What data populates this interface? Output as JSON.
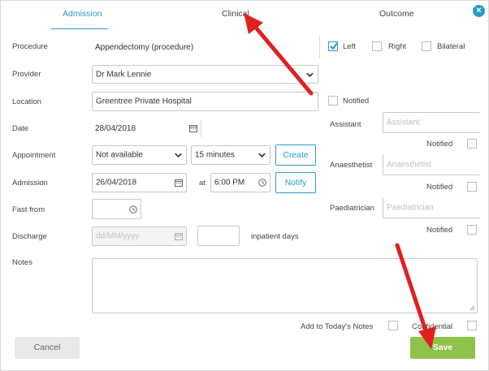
{
  "tabs": [
    {
      "label": "Admission",
      "active": true
    },
    {
      "label": "Clinical",
      "active": false
    },
    {
      "label": "Outcome",
      "active": false
    }
  ],
  "close_label": "×",
  "form": {
    "procedure": {
      "label": "Procedure",
      "value": "Appendectomy (procedure)"
    },
    "provider": {
      "label": "Provider",
      "value": "Dr Mark Lennie"
    },
    "location": {
      "label": "Location",
      "value": "Greentree Private Hospital"
    },
    "date": {
      "label": "Date",
      "value": "28/04/2018"
    },
    "appointment": {
      "label": "Appointment",
      "value": "Not available",
      "duration": "15 minutes",
      "create_label": "Create"
    },
    "admission": {
      "label": "Admission",
      "date": "26/04/2018",
      "at_label": "at",
      "time": "6:00 PM",
      "notify_label": "Notify"
    },
    "fast_from": {
      "label": "Fast from",
      "value": ""
    },
    "discharge": {
      "label": "Discharge",
      "placeholder": "dd/MM/yyyy",
      "days_suffix": "inpatient days"
    },
    "notes": {
      "label": "Notes",
      "value": ""
    }
  },
  "side": {
    "left_label": "Left",
    "left_checked": true,
    "right_label": "Right",
    "bilateral_label": "Bilateral",
    "notified_label": "Notified",
    "assistant": {
      "label": "Assistant",
      "placeholder": "Assistant",
      "notified_label": "Notified"
    },
    "anaesthetist": {
      "label": "Anaesthetist",
      "placeholder": "Anaesthetist",
      "notified_label": "Notified"
    },
    "paediatrician": {
      "label": "Paediatrician",
      "placeholder": "Paediatrician",
      "notified_label": "Notified"
    }
  },
  "footer": {
    "add_notes_label": "Add to Today's Notes",
    "confidential_label": "Confidential",
    "cancel_label": "Cancel",
    "save_label": "Save"
  },
  "colors": {
    "accent": "#2a9dc4",
    "save": "#8fc24a",
    "annotation_arrow": "#e02020"
  },
  "icons": {
    "close": "close-icon",
    "select": "chevron-down-icon",
    "calendar": "calendar-icon",
    "clock": "clock-icon",
    "check": "check-icon"
  }
}
